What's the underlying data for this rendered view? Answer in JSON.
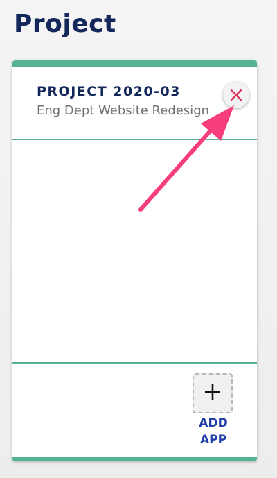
{
  "page": {
    "title": "Project"
  },
  "project_card": {
    "project_id": "PROJECT 2020-03",
    "project_name": "Eng Dept Website Redesign",
    "close_icon": "close-icon",
    "add_app": {
      "icon": "plus-icon",
      "label": "ADD APP"
    }
  },
  "colors": {
    "title": "#14275a",
    "accent_green": "#55b390",
    "close_x": "#d8365a",
    "add_app_label": "#1e3da8",
    "annotation_arrow": "#f53e7b"
  }
}
